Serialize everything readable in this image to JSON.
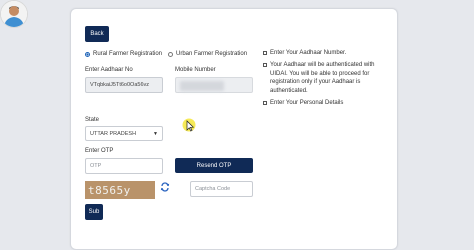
{
  "back_label": "Back",
  "registration": {
    "rural_label": "Rural Farmer Registration",
    "urban_label": "Urban Farmer Registration",
    "selected": "rural"
  },
  "aadhaar": {
    "label": "Enter Aadhaar No",
    "value": "VTqbkaiJ5Tt6o0Oa56vz"
  },
  "mobile": {
    "label": "Mobile Number"
  },
  "state": {
    "label": "State",
    "selected": "UTTAR PRADESH"
  },
  "otp": {
    "label": "Enter OTP",
    "placeholder": "OTP",
    "resend_label": "Resend OTP"
  },
  "captcha": {
    "image_text": "t8565y",
    "placeholder": "Captcha Code"
  },
  "submit_label": "Sub",
  "instructions": [
    "Enter Your Aadhaar Number.",
    "Your Aadhaar will be authenticated with UIDAI. You will be able to proceed for registration only if your Aadhaar is authenticated.",
    "Enter Your Personal Details"
  ],
  "colors": {
    "primary": "#102a56",
    "captcha_bg": "#b9936a",
    "refresh_icon": "#2b64c0",
    "cursor_highlight": "#f5e63a"
  }
}
